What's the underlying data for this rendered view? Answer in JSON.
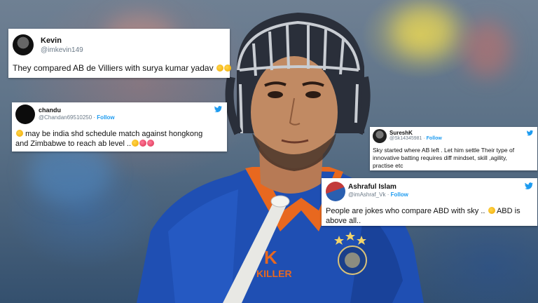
{
  "tweets": [
    {
      "name": "Kevin",
      "handle": "@imkevin149",
      "text": "They compared AB de Villiers with surya kumar yadav",
      "emojis": [
        "laugh",
        "laugh"
      ]
    },
    {
      "name": "chandu",
      "handle": "@Chandan69510250",
      "follow": "Follow",
      "text_line1": "may be india shd schedule match  against hongkong",
      "text_line2": "and Zimbabwe to reach ab level ..",
      "emojis_lead": [
        "laugh"
      ],
      "emojis_tail": [
        "laugh",
        "cry",
        "cry"
      ]
    },
    {
      "name": "SureshK",
      "handle": "@Sk14345981",
      "follow": "Follow",
      "text_line1": "Sky started where AB left . Let him settle Their type of",
      "text_line2": "innovative batting requires diff mindset, skill ,agility,",
      "text_line3": "practise etc"
    },
    {
      "name": "Ashraful Islam",
      "handle": "@imAshraf_Vk",
      "follow": "Follow",
      "text_line1": "People are jokes who compare ABD with sky ..",
      "text_line1b": "ABD is",
      "text_line2": "above all..",
      "emojis": [
        "laugh"
      ]
    }
  ],
  "jersey": {
    "sponsor_mark": "K",
    "sponsor_word": "KILLER"
  },
  "colors": {
    "twitter_blue": "#1d9bf0",
    "jersey_blue": "#1f4fb3",
    "helmet": "#2a2f3a"
  }
}
